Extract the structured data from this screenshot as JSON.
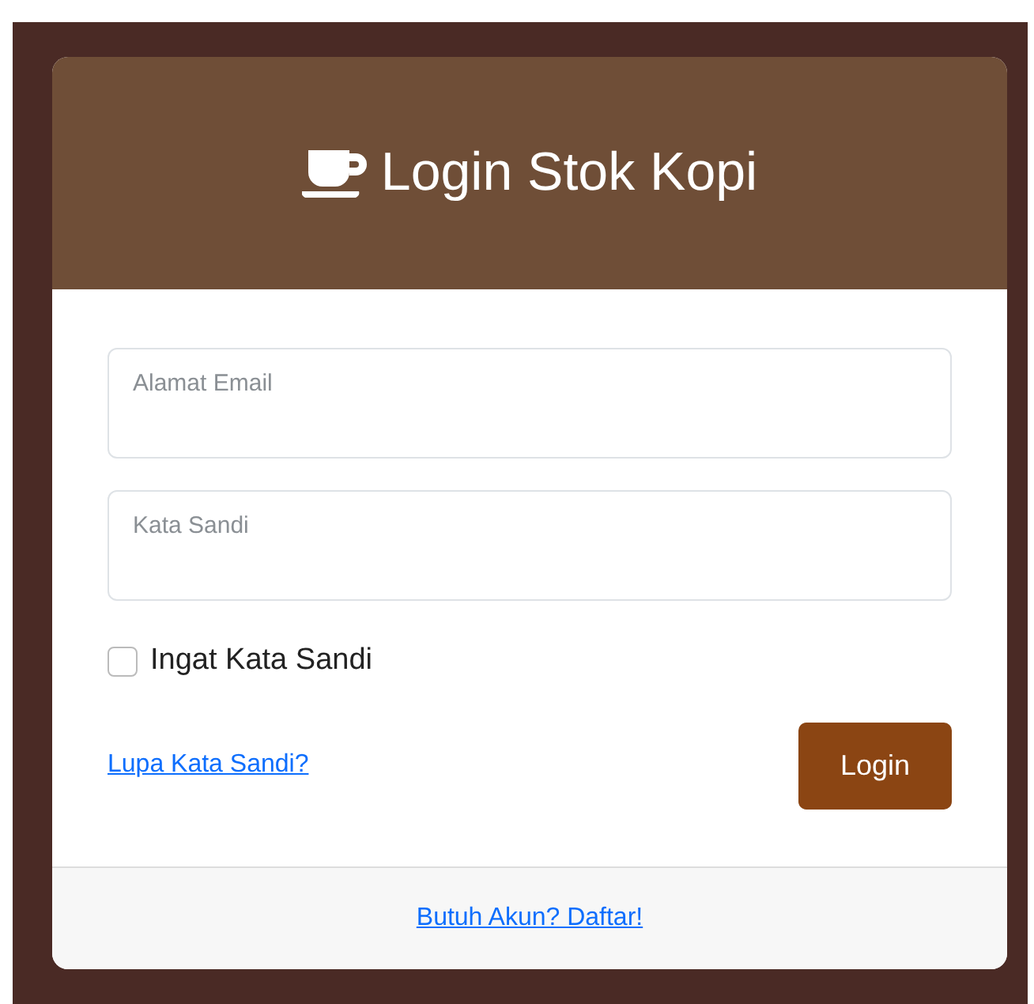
{
  "header": {
    "title": "Login Stok Kopi"
  },
  "fields": [
    {
      "placeholder": "Alamat Email"
    },
    {
      "placeholder": "Kata Sandi"
    }
  ],
  "remember": {
    "label": "Ingat Kata Sandi",
    "checked": false
  },
  "forgot_link": "Lupa Kata Sandi?",
  "login_button": "Login",
  "footer_link": "Butuh Akun? Daftar!"
}
